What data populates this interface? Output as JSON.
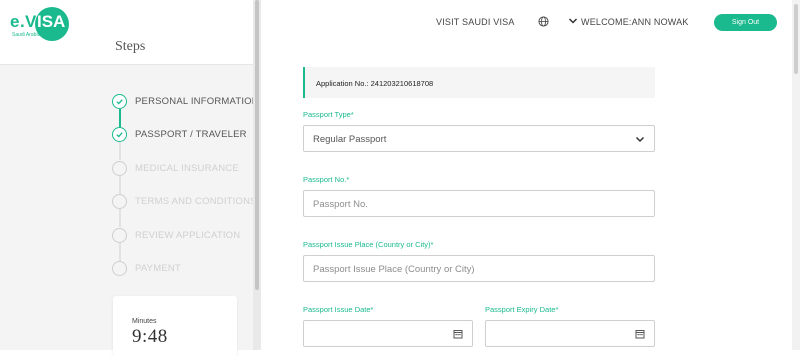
{
  "logo": {
    "brand": "e.VISA",
    "sub": "Saudi Arabia"
  },
  "sidebar": {
    "title": "Steps",
    "steps": [
      {
        "label": "PERSONAL INFORMATION",
        "done": true
      },
      {
        "label": "PASSPORT / TRAVELER",
        "done": true
      },
      {
        "label": "MEDICAL INSURANCE",
        "done": false
      },
      {
        "label": "TERMS AND CONDITIONS",
        "done": false
      },
      {
        "label": "REVIEW APPLICATION",
        "done": false
      },
      {
        "label": "PAYMENT",
        "done": false
      }
    ],
    "timer": {
      "label": "Minutes",
      "value": "9:48"
    }
  },
  "header": {
    "visit_link": "VISIT SAUDI VISA",
    "language_icon": "globe-icon",
    "welcome": "WELCOME:ANN NOWAK",
    "signout": "Sign Out"
  },
  "form": {
    "application_no": "Application No.: 241203210618708",
    "passport_type": {
      "label": "Passport Type*",
      "value": "Regular Passport"
    },
    "passport_no": {
      "label": "Passport No.*",
      "placeholder": "Passport No."
    },
    "issue_place": {
      "label": "Passport Issue Place (Country or City)*",
      "placeholder": "Passport Issue Place (Country or City)"
    },
    "issue_date": {
      "label": "Passport Issue Date*"
    },
    "expiry_date": {
      "label": "Passport Expiry Date*"
    }
  },
  "colors": {
    "accent": "#1bb98e",
    "sidebar_bg": "#f4f4f4"
  }
}
